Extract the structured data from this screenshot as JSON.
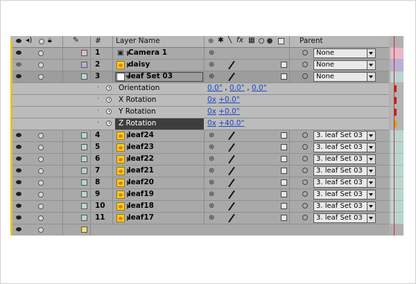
{
  "header": {
    "number_col": "#",
    "layer_name_col": "Layer Name",
    "parent_col": "Parent",
    "switch_labels": [
      "✱",
      "fx"
    ]
  },
  "layers": [
    {
      "num": "1",
      "name": "Camera 1",
      "type": "camera",
      "label_color": "#e7b9c9",
      "parent": "None",
      "visible": true
    },
    {
      "num": "2",
      "name": "daisy",
      "type": "leaf",
      "label_color": "#b7b1d7",
      "parent": "None",
      "visible": false
    },
    {
      "num": "3",
      "name": "leaf Set 03",
      "type": "solid",
      "label_color": "#b8d6d0",
      "parent": "None",
      "visible": true,
      "selected": true,
      "expanded": true
    }
  ],
  "properties": [
    {
      "name": "Orientation",
      "value_parts": [
        "0.0°",
        ",",
        "0.0°",
        ",",
        "0.0°"
      ]
    },
    {
      "name": "X Rotation",
      "value_parts": [
        "0x",
        "+0.0°"
      ]
    },
    {
      "name": "Y Rotation",
      "value_parts": [
        "0x",
        "+0.0°"
      ]
    },
    {
      "name": "Z Rotation",
      "value_parts": [
        "0x",
        "+40.0°"
      ],
      "highlighted": true
    }
  ],
  "child_layers": [
    {
      "num": "4",
      "name": "leaf24",
      "parent": "3. leaf Set 03"
    },
    {
      "num": "5",
      "name": "leaf23",
      "parent": "3. leaf Set 03"
    },
    {
      "num": "6",
      "name": "leaf22",
      "parent": "3. leaf Set 03"
    },
    {
      "num": "7",
      "name": "leaf21",
      "parent": "3. leaf Set 03"
    },
    {
      "num": "8",
      "name": "leaf20",
      "parent": "3. leaf Set 03"
    },
    {
      "num": "9",
      "name": "leaf19",
      "parent": "3. leaf Set 03"
    },
    {
      "num": "10",
      "name": "leaf18",
      "parent": "3. leaf Set 03"
    },
    {
      "num": "11",
      "name": "leaf17",
      "parent": "3. leaf Set 03"
    }
  ],
  "colors": {
    "panel_bg": "#a9a9a9",
    "accent_yellow": "#e2c31e",
    "value_blue": "#1a44c8",
    "time_indicator": "#dd2222",
    "child_label": "#b8d6d0"
  },
  "icons": [
    "eye-icon",
    "speaker-icon",
    "solo-icon",
    "lock-icon",
    "label-tag-icon",
    "shy-icon",
    "collapse-icon",
    "motion-blur-icon",
    "frame-blend-icon",
    "adjustment-icon",
    "3d-layer-icon",
    "camera-icon",
    "stopwatch-icon",
    "pickwhip-icon",
    "dropdown-arrow-icon",
    "keyframe-icon"
  ]
}
